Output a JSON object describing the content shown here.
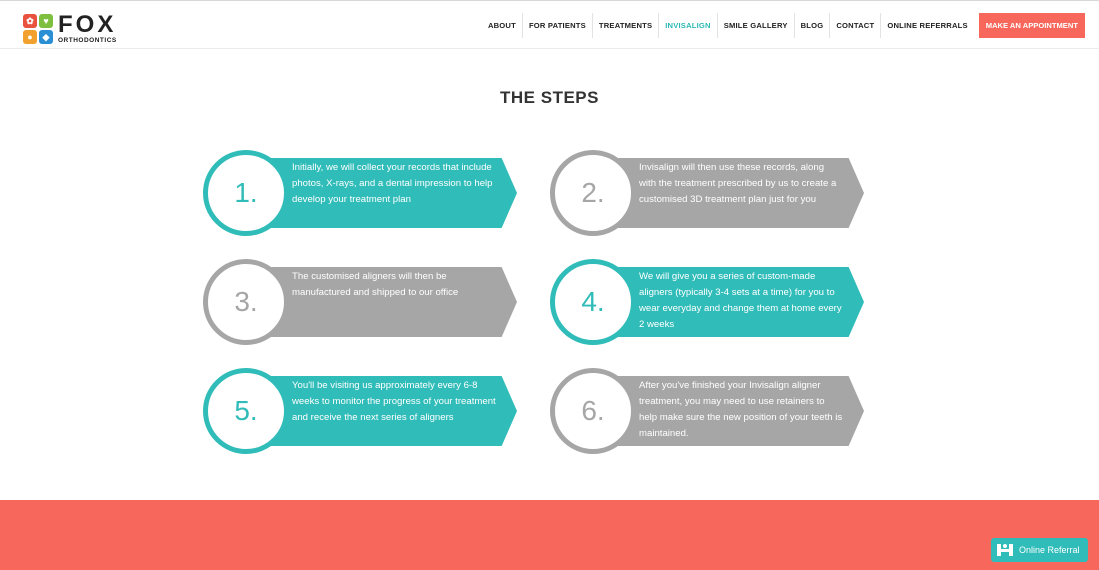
{
  "brand": {
    "name": "FOX",
    "subtitle": "ORTHODONTICS",
    "colors": {
      "teal": "#30bcb8",
      "grey": "#a6a6a6",
      "coral": "#f7675b"
    }
  },
  "nav": {
    "items": [
      {
        "label": "ABOUT"
      },
      {
        "label": "FOR PATIENTS"
      },
      {
        "label": "TREATMENTS"
      },
      {
        "label": "INVISALIGN",
        "active": true
      },
      {
        "label": "SMILE GALLERY"
      },
      {
        "label": "BLOG"
      },
      {
        "label": "CONTACT"
      },
      {
        "label": "ONLINE REFERRALS"
      }
    ],
    "cta_label": "MAKE AN APPOINTMENT"
  },
  "section": {
    "title": "THE STEPS"
  },
  "steps": [
    {
      "number": "1.",
      "color": "teal",
      "text": "Initially, we will collect your records that include photos, X-rays, and a dental impression to help develop your treatment plan"
    },
    {
      "number": "2.",
      "color": "grey",
      "text": "Invisalign will then use these records, along with the treatment prescribed by us to create a customised 3D treatment plan just for you"
    },
    {
      "number": "3.",
      "color": "grey",
      "text": "The customised aligners will then be manufactured and shipped to our office"
    },
    {
      "number": "4.",
      "color": "teal",
      "text": "We will give you a series of custom-made aligners (typically 3-4 sets at a time) for you to wear everyday and change them at home every 2 weeks"
    },
    {
      "number": "5.",
      "color": "teal",
      "text": "You'll be visiting us approximately every 6-8 weeks to monitor the progress of your treatment and receive the next series of aligners"
    },
    {
      "number": "6.",
      "color": "grey",
      "text": "After you've finished your Invisalign aligner treatment, you may need to use retainers to help make sure the new position of your teeth is maintained."
    }
  ],
  "referral_widget": {
    "label": "Online Referral",
    "icon": "referral-logo-icon"
  }
}
